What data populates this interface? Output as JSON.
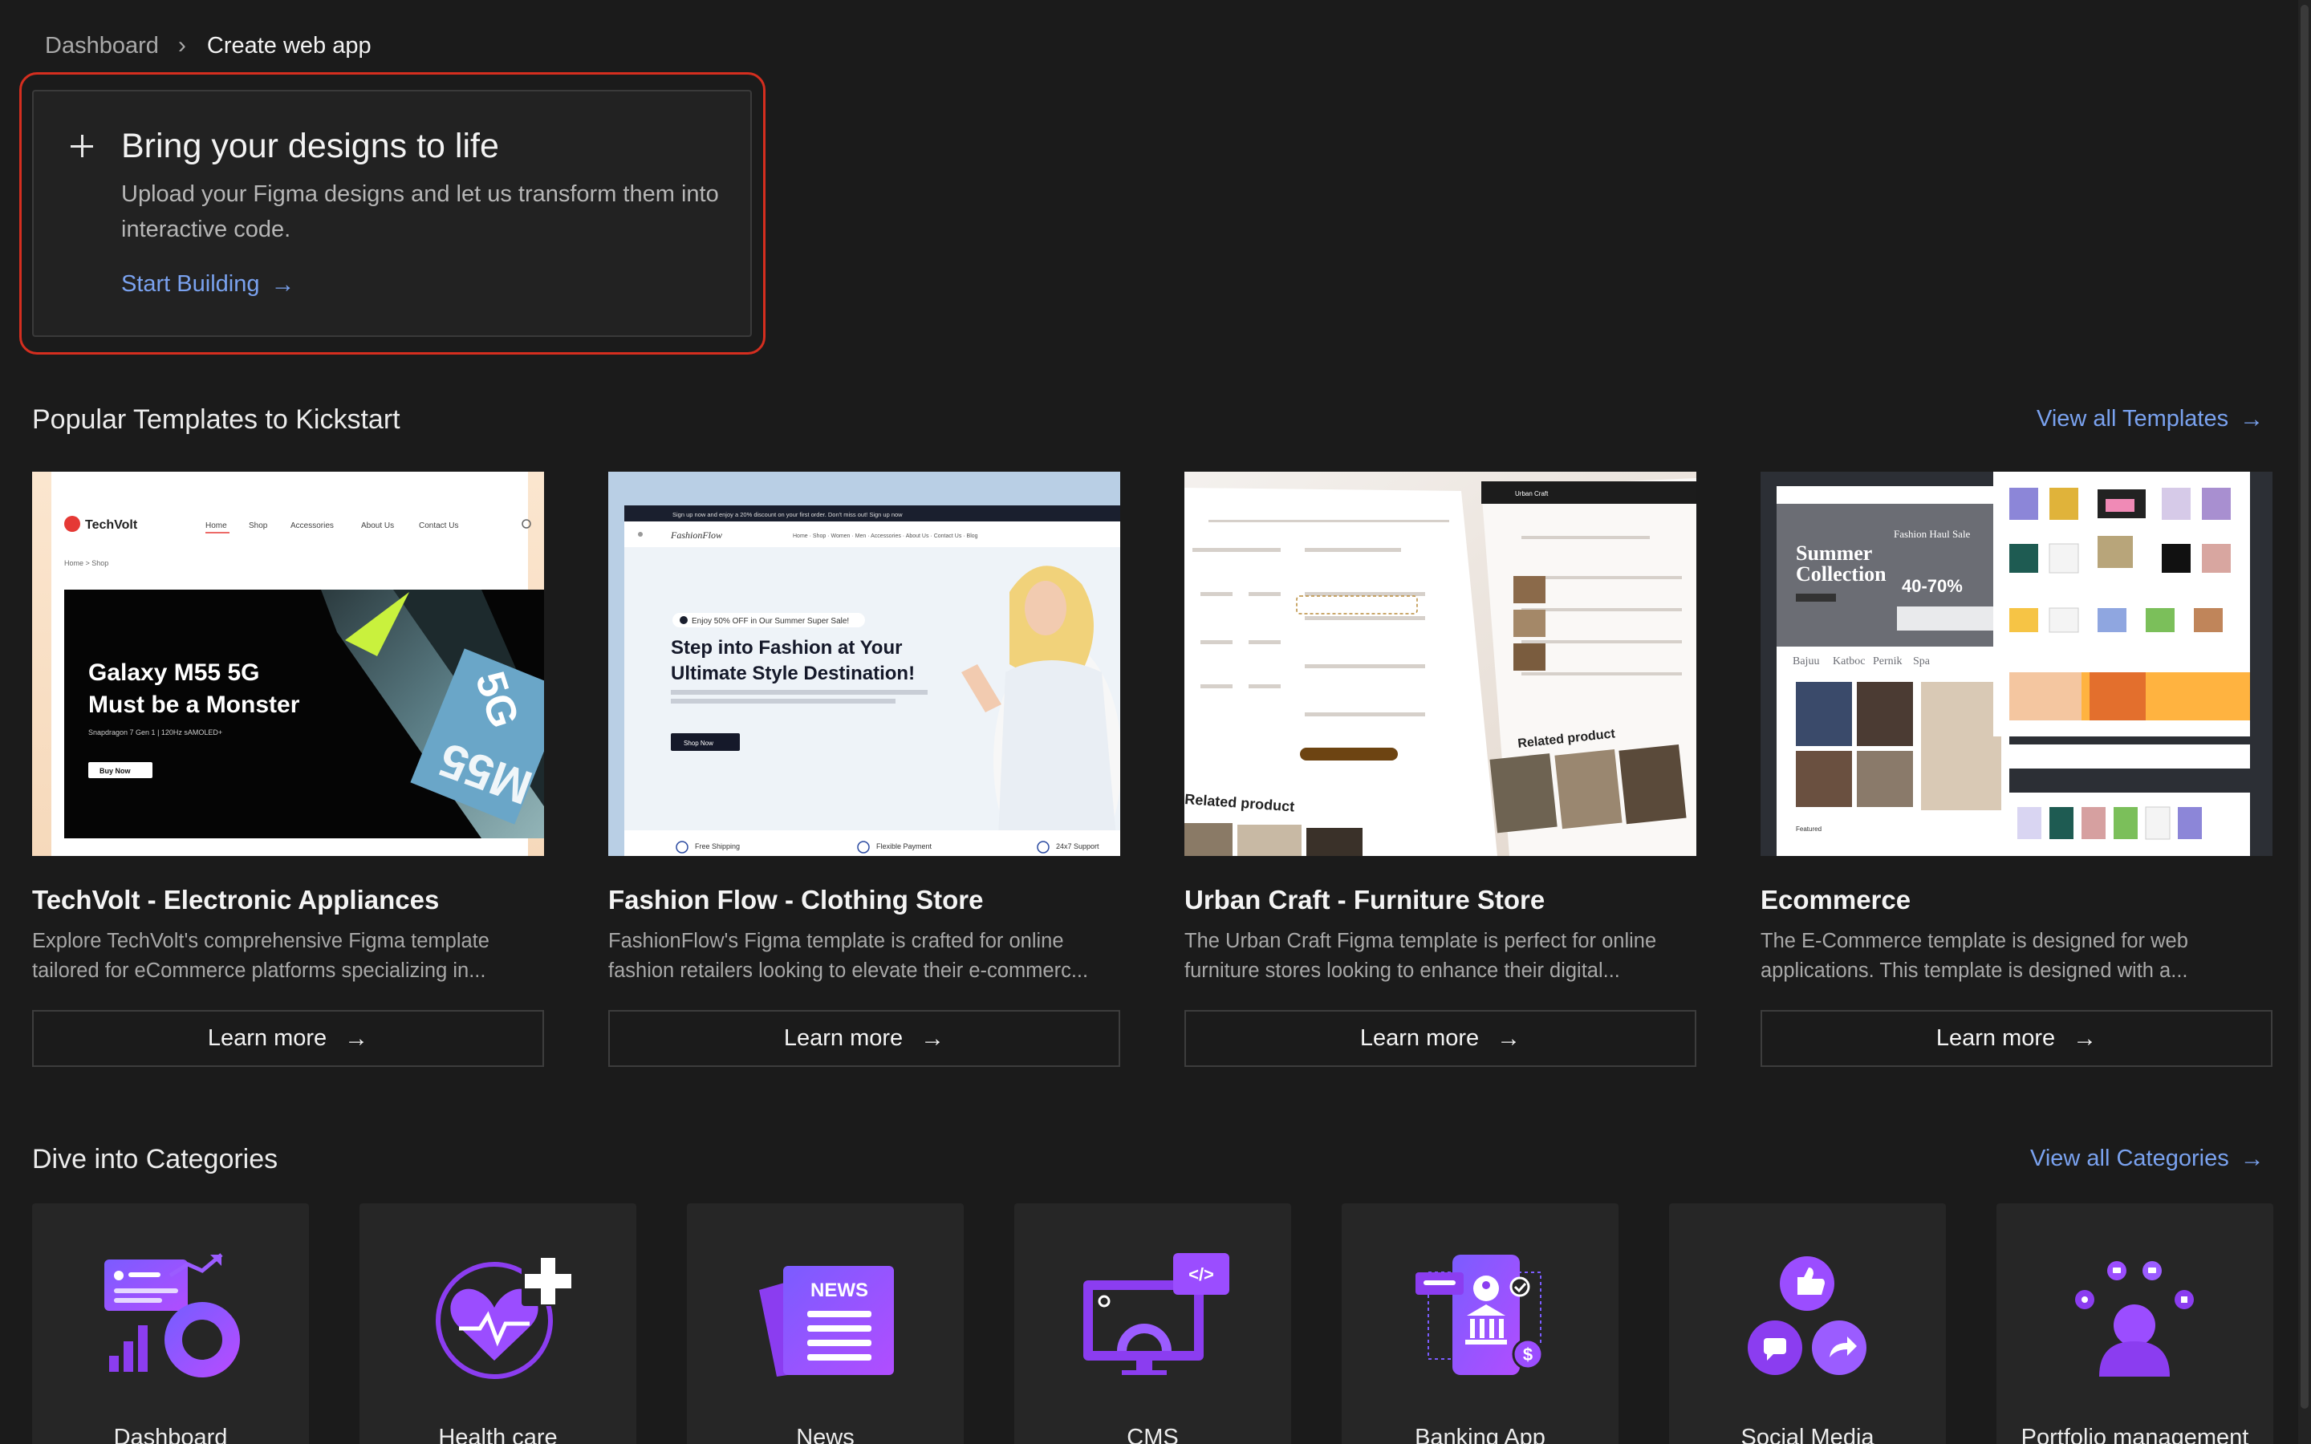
{
  "breadcrumb": {
    "root": "Dashboard",
    "current": "Create web app"
  },
  "upload": {
    "title": "Bring your designs to life",
    "description": "Upload your Figma designs and let us transform them into interactive code.",
    "cta": "Start Building"
  },
  "templates_section": {
    "title": "Popular Templates to Kickstart",
    "view_all": "View all Templates"
  },
  "templates": [
    {
      "title": "TechVolt - Electronic Appliances",
      "description": "Explore TechVolt's comprehensive Figma template tailored for eCommerce platforms specializing in...",
      "button": "Learn more",
      "thumb": {
        "brand": "TechVolt",
        "nav": [
          "Home",
          "Shop",
          "Accessories",
          "About Us",
          "Contact Us"
        ],
        "crumb": "Home  >  Shop",
        "headline1": "Galaxy M55 5G",
        "headline2": "Must be a Monster",
        "subline": "Snapdragon 7 Gen 1 | 120Hz sAMOLED+",
        "cta": "Buy Now",
        "badge": "5G",
        "model": "M55"
      }
    },
    {
      "title": "Fashion Flow - Clothing Store",
      "description": "FashionFlow's Figma template is crafted for online fashion retailers looking to elevate their e-commerc...",
      "button": "Learn more",
      "thumb": {
        "topbar": "Sign up now and enjoy a 20% discount on your first order. Don't miss out! Sign up now",
        "brand": "FashionFlow",
        "promo": "Enjoy 50% OFF in Our Summer Super Sale!",
        "headline1": "Step into Fashion at Your",
        "headline2": "Ultimate Style Destination!",
        "cta": "Shop Now",
        "features": [
          "Free Shipping",
          "Flexible Payment",
          "24x7 Support"
        ]
      }
    },
    {
      "title": "Urban Craft - Furniture Store",
      "description": "The Urban Craft Figma template is perfect for online furniture stores looking to enhance their digital...",
      "button": "Learn more",
      "thumb": {
        "brand": "Urban Craft",
        "related1": "Related product",
        "related2": "Related product"
      }
    },
    {
      "title": "Ecommerce",
      "description": "The E-Commerce template is designed for web applications. This template is designed with a...",
      "button": "Learn more",
      "thumb": {
        "hero1": "Summer",
        "hero2": "Collection",
        "sale": "Fashion Haul Sale",
        "discount": "40-70%",
        "tabs": [
          "Bajuu",
          "Katboc",
          "Pernik",
          "Spa"
        ],
        "featured": "Featured"
      }
    }
  ],
  "categories_section": {
    "title": "Dive into Categories",
    "view_all": "View all Categories"
  },
  "categories": [
    {
      "label": "Dashboard",
      "icon": "dashboard-icon"
    },
    {
      "label": "Health care",
      "icon": "health-care-icon"
    },
    {
      "label": "News",
      "icon": "news-icon",
      "icon_text": "NEWS"
    },
    {
      "label": "CMS",
      "icon": "cms-icon",
      "icon_text": "</>"
    },
    {
      "label": "Banking App",
      "icon": "banking-app-icon",
      "icon_text": "$"
    },
    {
      "label": "Social Media",
      "icon": "social-media-icon"
    },
    {
      "label": "Portfolio management",
      "icon": "portfolio-management-icon"
    }
  ],
  "colors": {
    "background": "#1b1b1b",
    "accent": "#7aa2ef",
    "highlight": "#d52e1f",
    "icon_purple": "#8b3df0"
  }
}
